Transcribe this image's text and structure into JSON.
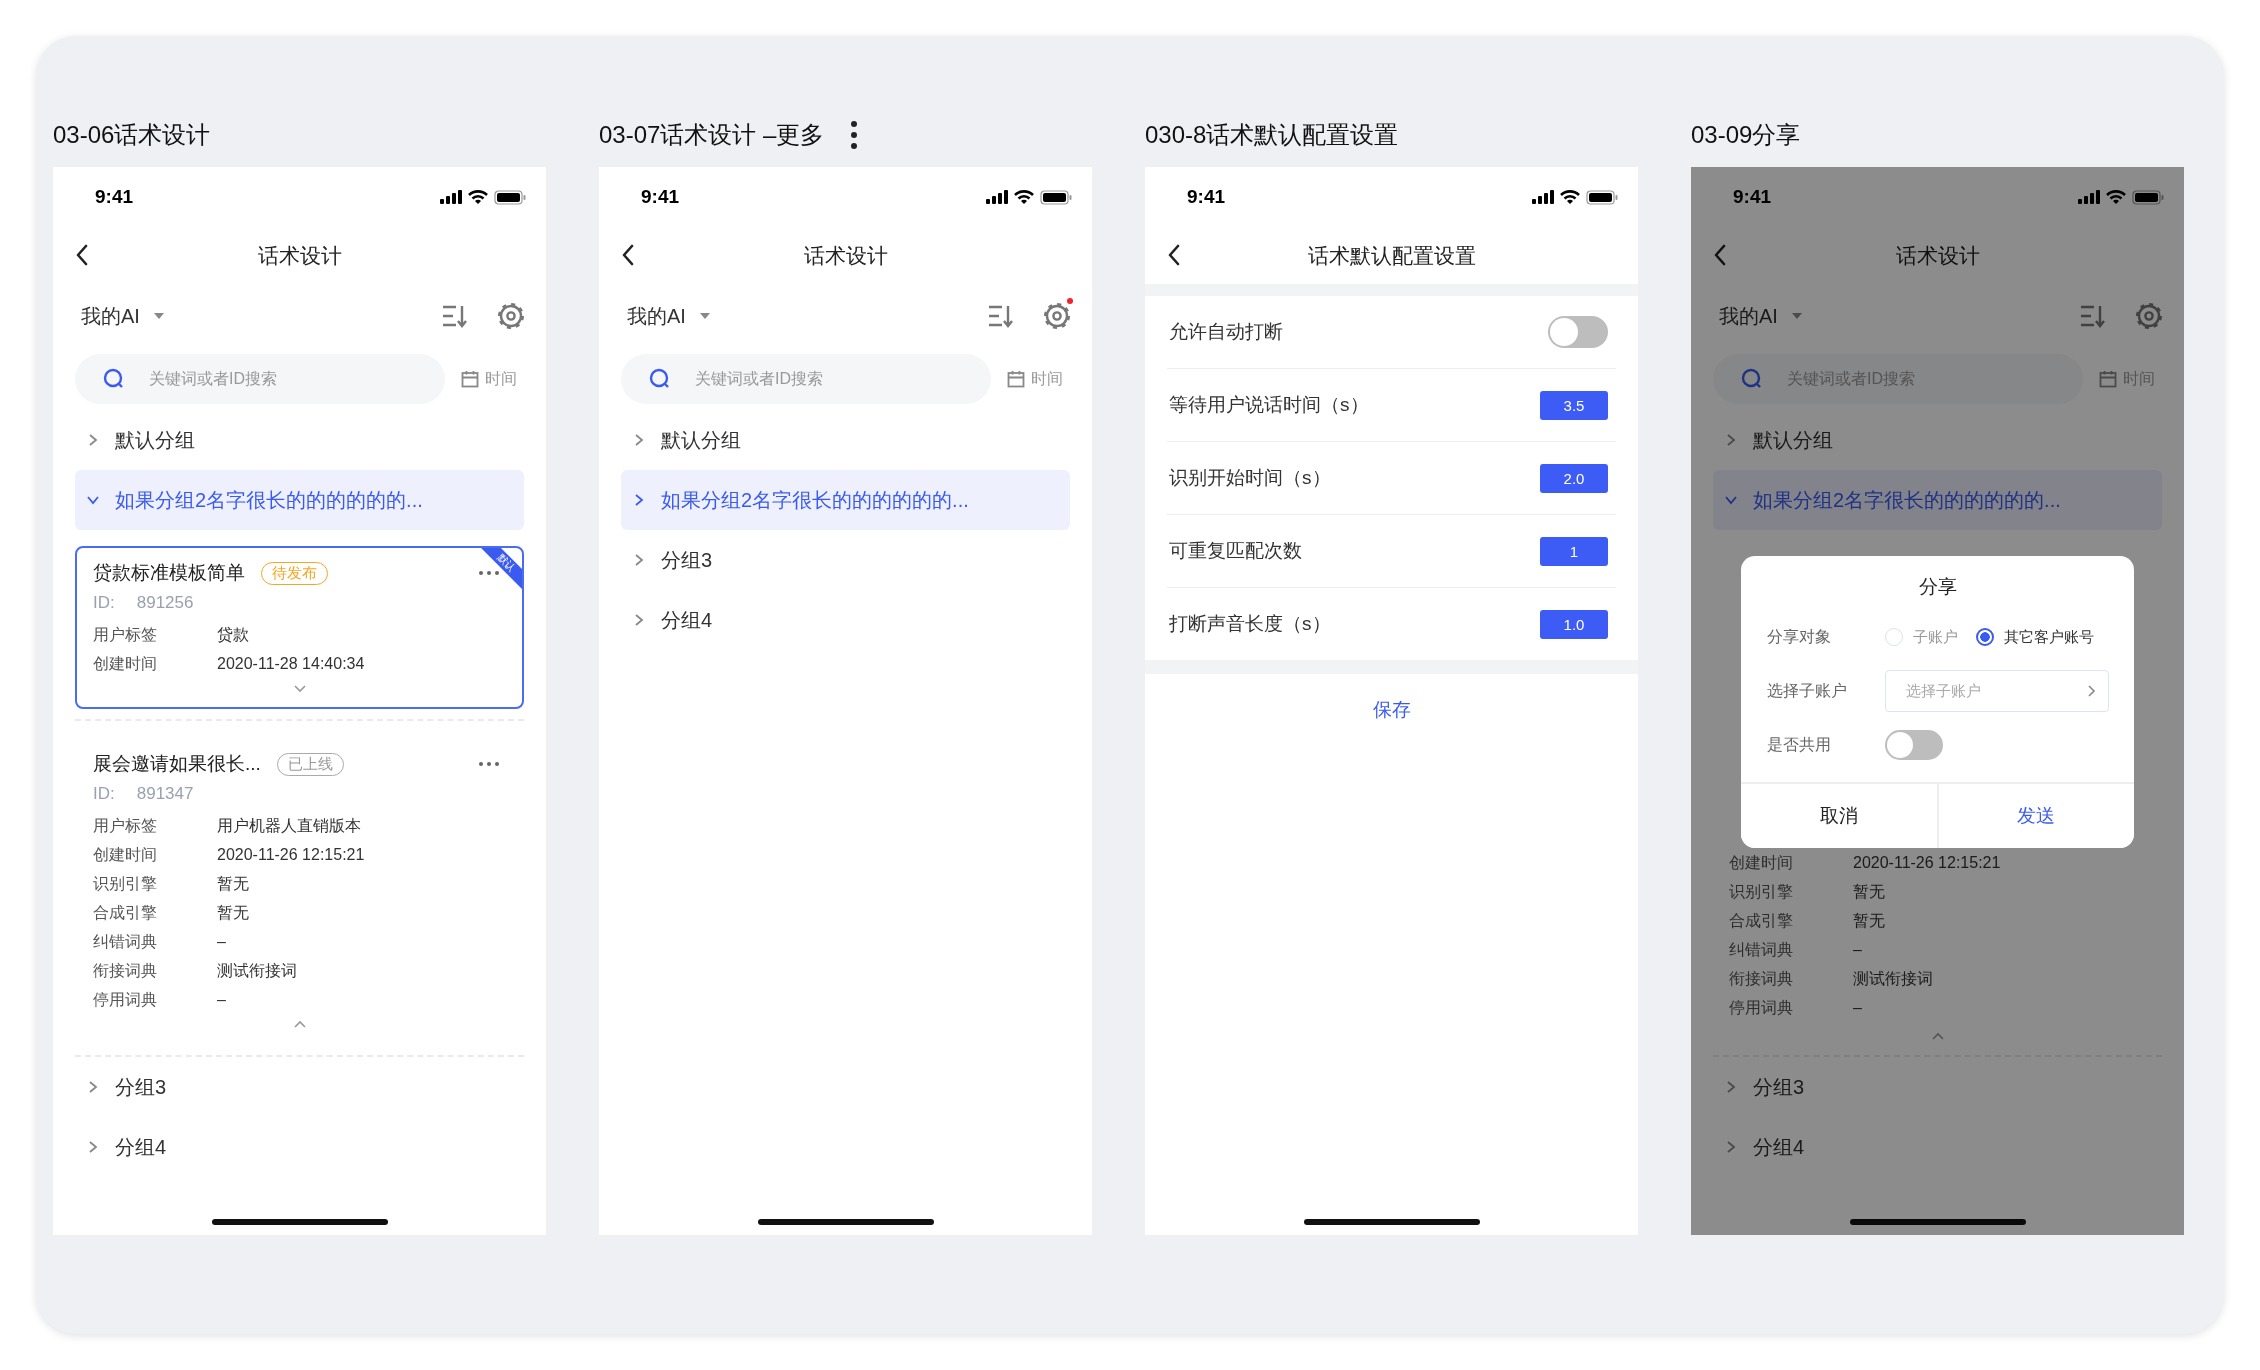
{
  "frames": [
    {
      "title": "03-06话术设计",
      "menu_icon": false,
      "kind": "list",
      "time": "9:41",
      "dimmed": false,
      "nav_title": "话术设计",
      "account": "我的AI",
      "settings_dot": false,
      "search": {
        "placeholder": "关键词或者ID搜索"
      },
      "date_filter": "时间",
      "groups": [
        {
          "name": "默认分组",
          "expanded": false,
          "selected": false
        },
        {
          "name": "如果分组2名字很长的的的的的的...",
          "expanded": true,
          "selected": true,
          "cards": [
            {
              "title": "贷款标准模板简单",
              "status": {
                "label": "待发布",
                "kind": "pending"
              },
              "ribbon": "默认",
              "selected": true,
              "expanded": false,
              "id_label": "ID:",
              "id": "891256",
              "fields": [
                {
                  "label": "用户标签",
                  "value": "贷款"
                },
                {
                  "label": "创建时间",
                  "value": "2020-11-28 14:40:34"
                }
              ]
            },
            {
              "title": "展会邀请如果很长...",
              "status": {
                "label": "已上线",
                "kind": "online"
              },
              "selected": false,
              "expanded": true,
              "id_label": "ID:",
              "id": "891347",
              "fields": [
                {
                  "label": "用户标签",
                  "value": "用户机器人直销版本"
                },
                {
                  "label": "创建时间",
                  "value": "2020-11-26 12:15:21"
                },
                {
                  "label": "识别引擎",
                  "value": "暂无"
                },
                {
                  "label": "合成引擎",
                  "value": "暂无"
                },
                {
                  "label": "纠错词典",
                  "value": "–"
                },
                {
                  "label": "衔接词典",
                  "value": "测试衔接词"
                },
                {
                  "label": "停用词典",
                  "value": "–"
                }
              ]
            }
          ]
        },
        {
          "name": "分组3",
          "expanded": false,
          "selected": false
        },
        {
          "name": "分组4",
          "expanded": false,
          "selected": false
        }
      ]
    },
    {
      "title": "03-07话术设计 –更多",
      "menu_icon": true,
      "kind": "list",
      "time": "9:41",
      "dimmed": false,
      "nav_title": "话术设计",
      "account": "我的AI",
      "settings_dot": true,
      "search": {
        "placeholder": "关键词或者ID搜索"
      },
      "date_filter": "时间",
      "groups": [
        {
          "name": "默认分组",
          "expanded": false,
          "selected": false
        },
        {
          "name": "如果分组2名字很长的的的的的的...",
          "expanded": false,
          "selected": true
        },
        {
          "name": "分组3",
          "expanded": false,
          "selected": false
        },
        {
          "name": "分组4",
          "expanded": false,
          "selected": false
        }
      ]
    },
    {
      "title": "030-8话术默认配置设置",
      "menu_icon": false,
      "kind": "settings",
      "time": "9:41",
      "nav_title": "话术默认配置设置",
      "rows": [
        {
          "kind": "switch",
          "label": "允许自动打断",
          "on": false
        },
        {
          "kind": "value",
          "label": "等待用户说话时间（s）",
          "value": "3.5"
        },
        {
          "kind": "value",
          "label": "识别开始时间（s）",
          "value": "2.0"
        },
        {
          "kind": "value",
          "label": "可重复匹配次数",
          "value": "1"
        },
        {
          "kind": "value",
          "label": "打断声音长度（s）",
          "value": "1.0"
        }
      ],
      "save": "保存"
    },
    {
      "title": "03-09分享",
      "menu_icon": false,
      "kind": "list",
      "time": "9:41",
      "dimmed": true,
      "nav_title": "话术设计",
      "account": "我的AI",
      "settings_dot": false,
      "search": {
        "placeholder": "关键词或者ID搜索"
      },
      "date_filter": "时间",
      "groups": [
        {
          "name": "默认分组",
          "expanded": false,
          "selected": false
        },
        {
          "name": "如果分组2名字很长的的的的的的...",
          "expanded": true,
          "selected": true,
          "cards": [
            {
              "covered": true,
              "expanded": true,
              "fields": [
                {
                  "label": "创建时间",
                  "value": "2020-11-26 12:15:21"
                },
                {
                  "label": "识别引擎",
                  "value": "暂无"
                },
                {
                  "label": "合成引擎",
                  "value": "暂无"
                },
                {
                  "label": "纠错词典",
                  "value": "–"
                },
                {
                  "label": "衔接词典",
                  "value": "测试衔接词"
                },
                {
                  "label": "停用词典",
                  "value": "–"
                }
              ]
            }
          ]
        },
        {
          "name": "分组3",
          "expanded": false,
          "selected": false
        },
        {
          "name": "分组4",
          "expanded": false,
          "selected": false
        }
      ],
      "dialog": {
        "title": "分享",
        "rows": [
          {
            "kind": "radio",
            "label": "分享对象",
            "options": [
              {
                "label": "子账户",
                "selected": false
              },
              {
                "label": "其它客户账号",
                "selected": true
              }
            ]
          },
          {
            "kind": "select",
            "label": "选择子账户",
            "placeholder": "选择子账户"
          },
          {
            "kind": "switch",
            "label": "是否共用",
            "on": false
          }
        ],
        "buttons": [
          {
            "label": "取消",
            "primary": false
          },
          {
            "label": "发送",
            "primary": true
          }
        ]
      }
    }
  ]
}
